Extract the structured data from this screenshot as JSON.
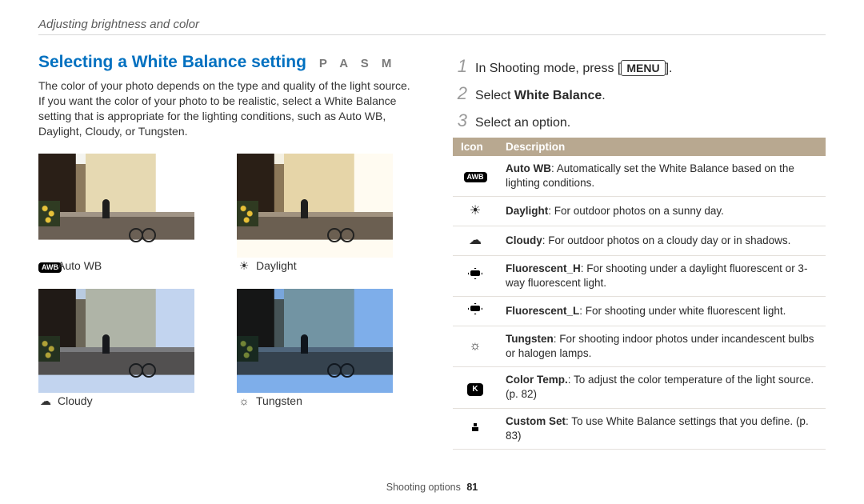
{
  "breadcrumb": "Adjusting brightness and color",
  "title": "Selecting a White Balance setting",
  "modes": "P A S M",
  "intro": "The color of your photo depends on the type and quality of the light source. If you want the color of your photo to be realistic, select a White Balance setting that is appropriate for the lighting conditions, such as Auto WB, Daylight, Cloudy, or Tungsten.",
  "samples": {
    "auto": {
      "label": "Auto WB",
      "icon_name": "auto-wb-icon"
    },
    "daylight": {
      "label": "Daylight",
      "icon_name": "daylight-icon"
    },
    "cloudy": {
      "label": "Cloudy",
      "icon_name": "cloudy-icon"
    },
    "tungsten": {
      "label": "Tungsten",
      "icon_name": "tungsten-icon"
    }
  },
  "steps": {
    "s1_pre": "In Shooting mode, press [",
    "s1_btn": "MENU",
    "s1_post": "].",
    "s2_pre": "Select ",
    "s2_b": "White Balance",
    "s2_post": ".",
    "s3": "Select an option."
  },
  "table": {
    "h_icon": "Icon",
    "h_desc": "Description",
    "rows": [
      {
        "icon": "AWB",
        "icon_name": "auto-wb-icon",
        "b": "Auto WB",
        "rest": ": Automatically set the White Balance based on the lighting conditions."
      },
      {
        "icon": "☀",
        "icon_name": "daylight-icon",
        "b": "Daylight",
        "rest": ": For outdoor photos on a sunny day."
      },
      {
        "icon": "☁",
        "icon_name": "cloudy-icon",
        "b": "Cloudy",
        "rest": ": For outdoor photos on a cloudy day or in shadows."
      },
      {
        "icon": "flH",
        "icon_name": "fluorescent-h-icon",
        "b": "Fluorescent_H",
        "rest": ": For shooting under a daylight fluorescent or 3-way fluorescent light."
      },
      {
        "icon": "flL",
        "icon_name": "fluorescent-l-icon",
        "b": "Fluorescent_L",
        "rest": ": For shooting under white fluorescent light."
      },
      {
        "icon": "bulb",
        "icon_name": "tungsten-icon",
        "b": "Tungsten",
        "rest": ": For shooting indoor photos under incandescent bulbs or halogen lamps."
      },
      {
        "icon": "K",
        "icon_name": "color-temp-icon",
        "b": "Color Temp.",
        "rest": ": To adjust the color temperature of the light source. (p. 82)"
      },
      {
        "icon": "cust",
        "icon_name": "custom-set-icon",
        "b": "Custom Set",
        "rest": ": To use White Balance settings that you define. (p. 83)"
      }
    ]
  },
  "footer": {
    "section": "Shooting options",
    "page": "81"
  }
}
